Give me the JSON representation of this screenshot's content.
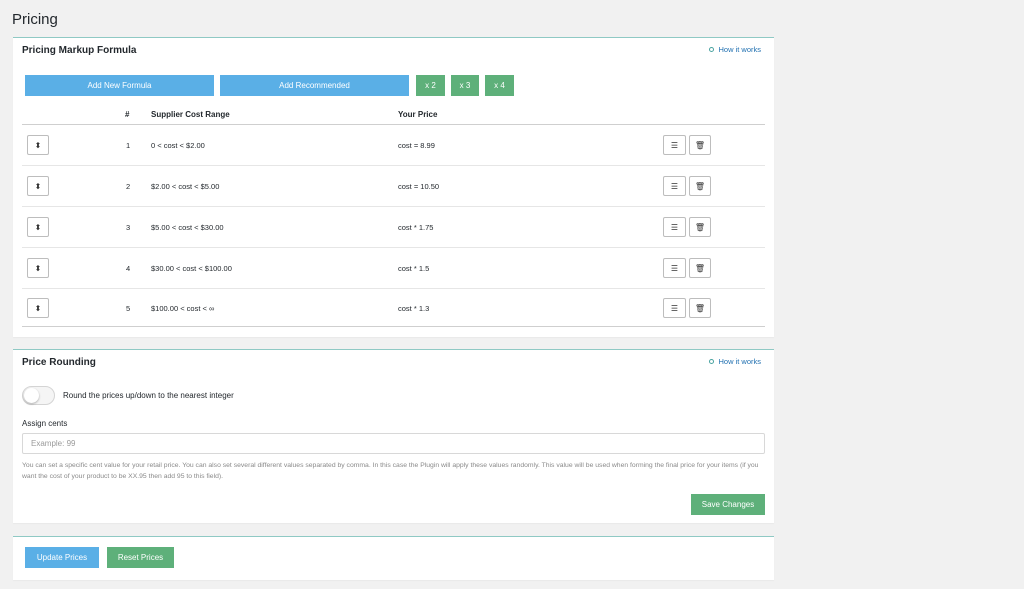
{
  "page": {
    "title": "Pricing"
  },
  "markup": {
    "title": "Pricing Markup Formula",
    "how_it_works": "How it works",
    "buttons": {
      "add_new": "Add New Formula",
      "add_recommended": "Add Recommended",
      "x2": "x 2",
      "x3": "x 3",
      "x4": "x 4"
    },
    "columns": {
      "num": "#",
      "range": "Supplier Cost Range",
      "price": "Your Price"
    },
    "rows": [
      {
        "num": "1",
        "range": "0 < cost < $2.00",
        "price": "cost = 8.99"
      },
      {
        "num": "2",
        "range": "$2.00 < cost < $5.00",
        "price": "cost = 10.50"
      },
      {
        "num": "3",
        "range": "$5.00 < cost < $30.00",
        "price": "cost * 1.75"
      },
      {
        "num": "4",
        "range": "$30.00 < cost < $100.00",
        "price": "cost * 1.5"
      },
      {
        "num": "5",
        "range": "$100.00 < cost < ∞",
        "price": "cost * 1.3"
      }
    ]
  },
  "rounding": {
    "title": "Price Rounding",
    "how_it_works": "How it works",
    "toggle_label": "Round the prices up/down to the nearest integer",
    "assign_label": "Assign cents",
    "input_placeholder": "Example: 99",
    "help_text": "You can set a specific cent value for your retail price. You can also set several different values separated by comma. In this case the Plugin will apply these values randomly. This value will be used when forming the final price for your items (if you want the cost of your product to be XX.95 then add 95 to this field).",
    "save_label": "Save Changes"
  },
  "actions": {
    "update_label": "Update Prices",
    "reset_label": "Reset Prices"
  },
  "colors": {
    "blue": "#5aafe6",
    "green": "#5eb07a",
    "accent_line": "#8fc9c4"
  }
}
